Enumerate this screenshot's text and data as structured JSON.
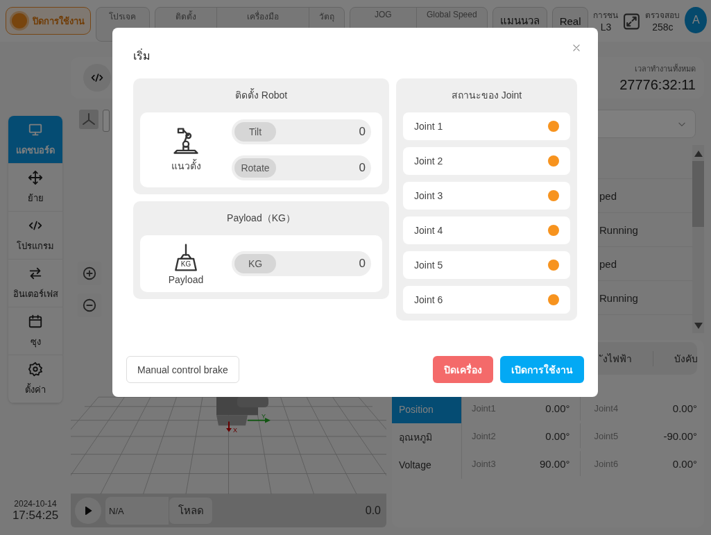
{
  "header": {
    "status": {
      "label": "ปิดการใช้งาน"
    },
    "groups": [
      [
        {
          "label": "โปรเจค"
        }
      ],
      [
        {
          "label": "ติดตั้ง"
        },
        {
          "label": "เครื่องมือ"
        },
        {
          "label": "วัตถุ"
        }
      ],
      [
        {
          "label": "JOG"
        },
        {
          "label": "Global Speed"
        }
      ]
    ],
    "mode_buttons": [
      {
        "label": "แมนนวล"
      },
      {
        "label": "Real"
      }
    ],
    "collision": {
      "label": "การชน",
      "value": "L3"
    },
    "inspection": {
      "label": "ตรวจสอบ",
      "value": "258c"
    },
    "avatar": "A"
  },
  "sidebar": {
    "items": [
      {
        "label": "แดชบอร์ด",
        "selected": true
      },
      {
        "label": "ย้าย",
        "selected": false
      },
      {
        "label": "โปรแกรม",
        "selected": false
      },
      {
        "label": "อินเตอร์เฟส",
        "selected": false
      },
      {
        "label": "ซุง",
        "selected": false
      },
      {
        "label": "ตั้งค่า",
        "selected": false
      }
    ],
    "date": "2024-10-14",
    "time": "17:54:25"
  },
  "program_bar": {
    "total_time_label": "เวลาทำงานทั้งหมด",
    "total_time": "27776:32:11"
  },
  "viewer": {
    "axis_labels": [
      "X",
      "Y"
    ],
    "player": {
      "program": "N/A",
      "load_button": "โหลด",
      "reading": "0.0"
    }
  },
  "task_list": {
    "rows": [
      {
        "status": "ped"
      },
      {
        "status": "Running"
      },
      {
        "status": "ped"
      },
      {
        "status": "Running"
      }
    ]
  },
  "joint_panel": {
    "tabs": [
      {
        "label": "ังไฟฟ้า",
        "selected": false
      },
      {
        "label": "บังคับ",
        "selected": false
      }
    ],
    "side_tabs": [
      {
        "label": "Position",
        "selected": true
      },
      {
        "label": "อุณหภูมิ",
        "selected": false
      },
      {
        "label": "Voltage",
        "selected": false
      }
    ],
    "values": [
      {
        "name": "Joint1",
        "value": "0.00°"
      },
      {
        "name": "Joint4",
        "value": "0.00°"
      },
      {
        "name": "Joint2",
        "value": "0.00°"
      },
      {
        "name": "Joint5",
        "value": "-90.00°"
      },
      {
        "name": "Joint3",
        "value": "90.00°"
      },
      {
        "name": "Joint6",
        "value": "0.00°"
      }
    ]
  },
  "dialog": {
    "title": "เริ่ม",
    "install": {
      "title": "ติดตั้ง Robot",
      "caption": "แนวตั้ง",
      "fields": [
        {
          "label": "Tilt",
          "value": "0"
        },
        {
          "label": "Rotate",
          "value": "0"
        }
      ]
    },
    "payload": {
      "title": "Payload（KG）",
      "caption": "Payload",
      "icon_text": "KG",
      "fields": [
        {
          "label": "KG",
          "value": "0"
        }
      ]
    },
    "joints": {
      "title": "สถานะของ Joint",
      "items": [
        {
          "name": "Joint 1",
          "color": "#f7931e"
        },
        {
          "name": "Joint 2",
          "color": "#f7931e"
        },
        {
          "name": "Joint 3",
          "color": "#f7931e"
        },
        {
          "name": "Joint 4",
          "color": "#f7931e"
        },
        {
          "name": "Joint 5",
          "color": "#f7931e"
        },
        {
          "name": "Joint 6",
          "color": "#f7931e"
        }
      ]
    },
    "brake_button": "Manual control brake",
    "off_button": "ปิดเครื่อง",
    "enable_button": "เปิดการใช้งาน"
  }
}
